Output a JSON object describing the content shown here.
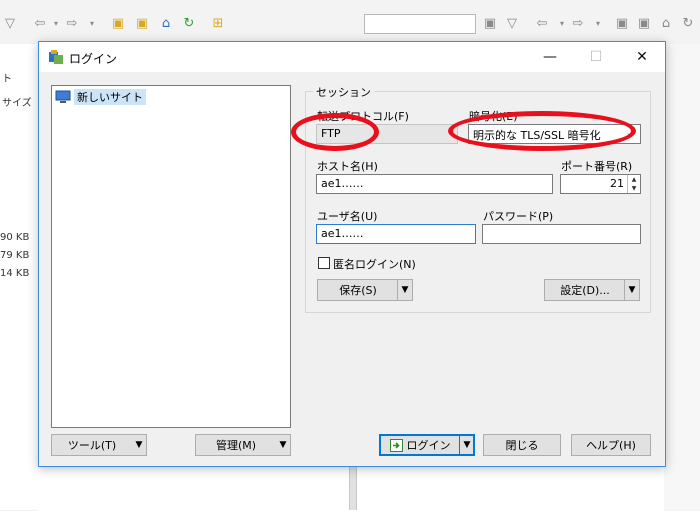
{
  "background": {
    "sidebar_header_left": "ト",
    "sidebar_col_size": "サイズ",
    "file_sizes": [
      "90 KB",
      "79 KB",
      "14 KB"
    ]
  },
  "dialog": {
    "title": "ログイン",
    "tree": {
      "items": [
        {
          "label": "新しいサイト"
        }
      ]
    },
    "session": {
      "legend": "セッション",
      "protocol": {
        "label": "転送プロトコル(F)",
        "value": "FTP"
      },
      "encryption": {
        "label": "暗号化(E)",
        "value": "明示的な TLS/SSL 暗号化"
      },
      "host": {
        "label": "ホスト名(H)",
        "value": "ae1……"
      },
      "port": {
        "label": "ポート番号(R)",
        "value": "21"
      },
      "user": {
        "label": "ユーザ名(U)",
        "value": "ae1……"
      },
      "password": {
        "label": "パスワード(P)",
        "value": ""
      },
      "anonymous": {
        "label": "匿名ログイン(N)",
        "checked": false
      },
      "save_label": "保存(S)",
      "advanced_label": "設定(D)..."
    },
    "buttons": {
      "tools": "ツール(T)",
      "manage": "管理(M)",
      "login": "ログイン",
      "close": "閉じる",
      "help": "ヘルプ(H)"
    }
  },
  "colors": {
    "accent": "#0078d7",
    "annotation": "#e8101c",
    "selection": "#cce4f7"
  }
}
